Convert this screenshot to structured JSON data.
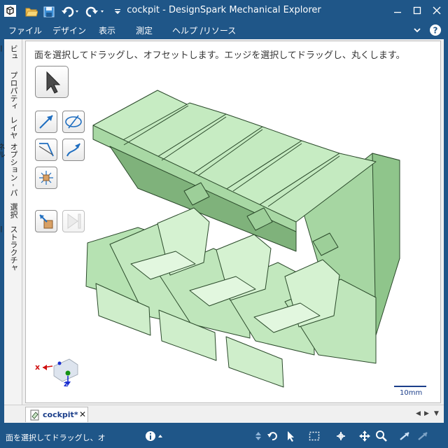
{
  "window": {
    "title": "cockpit - DesignSpark Mechanical Explorer",
    "controls": [
      "minimize-icon",
      "maximize-icon",
      "close-icon"
    ]
  },
  "quick_access": [
    "open-folder-icon",
    "save-icon",
    "undo-icon",
    "redo-icon",
    "customize-icon"
  ],
  "menu": {
    "items": [
      "ファイル",
      "デザイン",
      "表示",
      "測定",
      "ヘルプ /リソース"
    ],
    "right_icons": [
      "chevron-down-icon",
      "help-icon"
    ]
  },
  "side_tabs": [
    "ビュー",
    "プロパティ",
    "レイヤ",
    "オプション - パネル",
    "選択",
    "ストラクチャー"
  ],
  "viewport": {
    "hint": "面を選択してドラッグし、オフセットします。エッジを選択してドラッグし、丸くします。",
    "scale_label": "10mm",
    "axis_x": "x",
    "axis_z": "z"
  },
  "tools": [
    "select-arrow-icon",
    "pull-icon",
    "move-icon",
    "blend-icon",
    "sweep-icon",
    "combine-icon",
    "measure-icon",
    "play-icon"
  ],
  "doc_tab": {
    "label": "cockpit*",
    "close": "✕"
  },
  "status": {
    "text": "面を選択してドラッグし、オフセットします。",
    "accent": "#1f5688"
  },
  "colors": {
    "model_fill": "#b4e0b0",
    "model_edge": "#2b4a2b",
    "frame": "#1f5688"
  }
}
